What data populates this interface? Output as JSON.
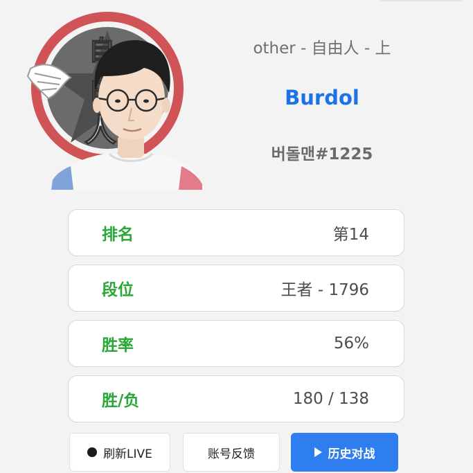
{
  "profile": {
    "team_line": "other - 自由人 - 上",
    "player_name": "Burdol",
    "riot_id": "버돌맨#1225",
    "logo_text": "自由人"
  },
  "stats": [
    {
      "label": "排名",
      "value": "第14"
    },
    {
      "label": "段位",
      "value": "王者 - 1796"
    },
    {
      "label": "胜率",
      "value": "56%"
    },
    {
      "label": "胜/负",
      "value": "180 / 138"
    }
  ],
  "actions": {
    "refresh_label": "刷新LIVE",
    "feedback_label": "账号反馈",
    "history_label": "历史对战"
  },
  "colors": {
    "accent_blue": "#2f7ef0",
    "name_blue": "#1c73e8",
    "label_green": "#27a837",
    "logo_red": "#d05457"
  },
  "icons": {
    "refresh": "dot-icon",
    "history": "play-icon"
  }
}
